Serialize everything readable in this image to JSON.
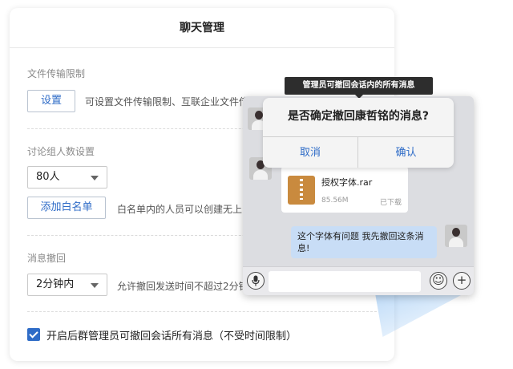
{
  "panel": {
    "title": "聊天管理"
  },
  "file_limit": {
    "label": "文件传输限制",
    "button": "设置",
    "description": "可设置文件传输限制、互联企业文件传输"
  },
  "group_size": {
    "label": "讨论组人数设置",
    "selected": "80人",
    "whitelist_button": "添加白名单",
    "description": "白名单内的人员可以创建无上限"
  },
  "recall": {
    "label": "消息撤回",
    "selected": "2分钟内",
    "description": "允许撤回发送时间不超过2分钟"
  },
  "admin_recall": {
    "checked": true,
    "label": "开启后群管理员可撤回会话所有消息（不受时间限制）"
  },
  "tooltip": "管理员可撤回会话内的所有消息",
  "dialog": {
    "title": "是否确定撤回康哲铭的消息?",
    "cancel": "取消",
    "confirm": "确认"
  },
  "chat": {
    "file": {
      "name": "授权字体.rar",
      "size": "85.56M",
      "status": "已下载"
    },
    "message": "这个字体有问题 我先撤回这条消息!",
    "emoji_icon": "☺",
    "plus_icon": "+"
  }
}
